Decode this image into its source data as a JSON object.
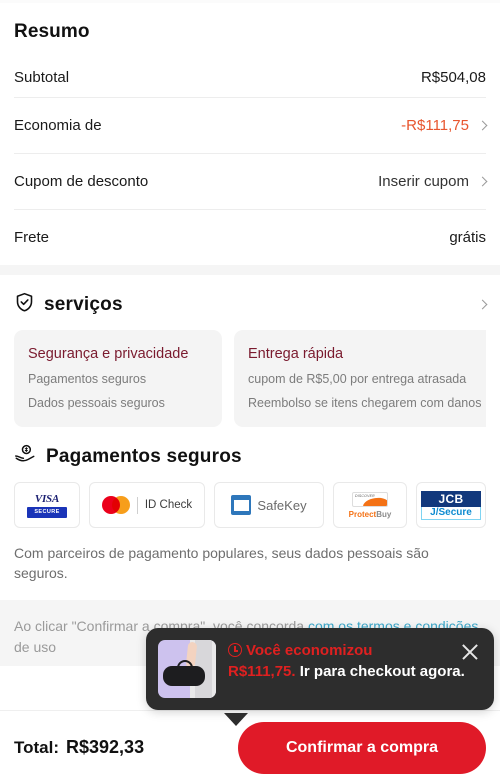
{
  "summary": {
    "title": "Resumo",
    "rows": [
      {
        "label": "Subtotal",
        "value": "R$504,08",
        "accent": false,
        "chevron": false
      },
      {
        "label": "Economia de",
        "value": "-R$111,75",
        "accent": true,
        "chevron": true
      },
      {
        "label": "Cupom de desconto",
        "value": "Inserir cupom",
        "accent": false,
        "chevron": true
      },
      {
        "label": "Frete",
        "value": "grátis",
        "accent": false,
        "chevron": false
      }
    ]
  },
  "services": {
    "icon": "shield-check-icon",
    "title": "serviços",
    "chevron": "chevron-right-icon",
    "cards": [
      {
        "title": "Segurança e privacidade",
        "lines": [
          "Pagamentos seguros",
          "Dados pessoais seguros"
        ]
      },
      {
        "title": "Entrega rápida",
        "lines": [
          "cupom de R$5,00 por entrega atrasada",
          "Reembolso se itens chegarem com danos"
        ]
      }
    ]
  },
  "payments": {
    "icon": "hand-coin-icon",
    "title": "Pagamentos seguros",
    "logos": [
      {
        "name": "visa-secure-logo",
        "brand": "VISA",
        "sub": "SECURE"
      },
      {
        "name": "mastercard-id-check-logo",
        "brand": "",
        "sub": "ID Check"
      },
      {
        "name": "amex-safekey-logo",
        "brand": "SafeKey",
        "sub": ""
      },
      {
        "name": "discover-protectbuy-logo",
        "brand": "Protect",
        "sub": "Buy"
      },
      {
        "name": "jcb-jsecure-logo",
        "brand": "JCB",
        "sub": "J/Secure"
      }
    ],
    "note": "Com parceiros de pagamento populares, seus dados pessoais são seguros."
  },
  "terms": {
    "prefix": "Ao clicar \"Confirmar a compra\", você concorda",
    "link": "com os termos e condições",
    "suffix": "de uso"
  },
  "toast": {
    "icon": "clock-icon",
    "thumb": "product-thumbnail",
    "headline": "Você economizou",
    "amount": "R$111,75.",
    "cta": "Ir para checkout agora.",
    "close": "close-icon",
    "ghost_text": "Confirmar a compra, você concorda de uso"
  },
  "bottom": {
    "total_label": "Total:",
    "total_value": "R$392,33",
    "confirm_label": "Confirmar a compra"
  },
  "colors": {
    "accent_red": "#e01a28",
    "savings_orange": "#e8552e",
    "card_title": "#7a1a2e",
    "link_blue": "#3aa7c9",
    "toast_bg": "#2d2d2d"
  }
}
